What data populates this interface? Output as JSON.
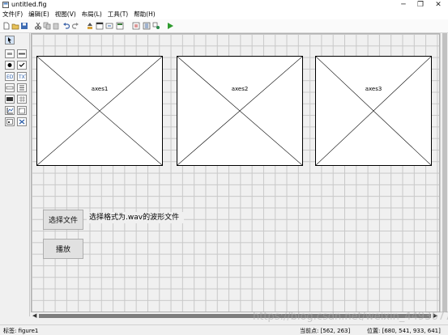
{
  "window": {
    "title": "untitled.fig",
    "minimize": "─",
    "maximize": "❐",
    "close": "✕"
  },
  "menu": [
    "文件(F)",
    "编辑(E)",
    "视图(V)",
    "布局(L)",
    "工具(T)",
    "帮助(H)"
  ],
  "axes": [
    {
      "label": "axes1"
    },
    {
      "label": "axes2"
    },
    {
      "label": "axes3"
    }
  ],
  "controls": {
    "select_file_button": "选择文件",
    "file_hint_text": "选择格式为.wav的波形文件",
    "play_button": "播放"
  },
  "statusbar": {
    "tag": "标签: figure1",
    "current_point": "当前点: [562, 263]",
    "position": "位置: [680, 541, 933, 641]"
  },
  "watermark": "https://blog.csdn.net/weixin_4493677",
  "colors": {
    "accent_run": "#2e9b2e",
    "canvas": "#f0f0f0",
    "grid": "#c8c8c8"
  }
}
